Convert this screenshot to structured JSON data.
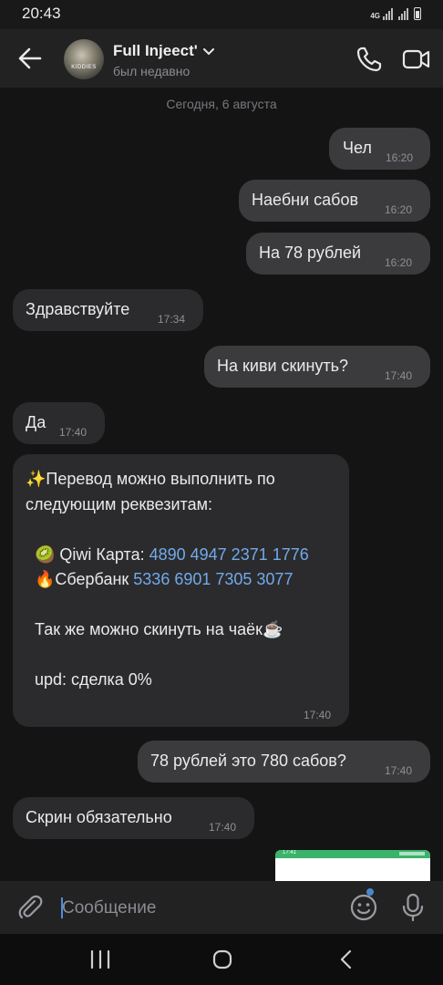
{
  "status_bar": {
    "time": "20:43",
    "network": "4G"
  },
  "header": {
    "back_icon": "arrow-left-icon",
    "avatar_text": "KIDDIES",
    "name": "Full Injeect'",
    "status": "был недавно",
    "call_icon": "phone-icon",
    "video_icon": "video-camera-icon"
  },
  "chat": {
    "date_separator": "Сегодня, 6 августа",
    "messages": [
      {
        "direction": "out",
        "text": "Чел",
        "time": "16:20"
      },
      {
        "direction": "out",
        "text": "Наебни сабов",
        "time": "16:20"
      },
      {
        "direction": "out",
        "text": "На 78 рублей",
        "time": "16:20"
      },
      {
        "direction": "in",
        "text": "Здравствуйте",
        "time": "17:34"
      },
      {
        "direction": "out",
        "text": "На киви скинуть?",
        "time": "17:40"
      },
      {
        "direction": "in",
        "text": "Да",
        "time": "17:40"
      },
      {
        "direction": "in",
        "time": "17:40",
        "parts": {
          "line1": "✨Перевод можно выполнить по",
          "line2": "следующим реквезитам:",
          "qiwi_label": "  🥝 Qiwi Карта: ",
          "qiwi_number": "4890 4947 2371 1776",
          "sber_label": "  🔥Сбербанк ",
          "sber_number": "5336 6901 7305 3077",
          "tea": "  Так же можно скинуть на чаёк☕",
          "upd": "  upd: сделка 0%"
        }
      },
      {
        "direction": "out",
        "text": "78 рублей это 780 сабов?",
        "time": "17:40"
      },
      {
        "direction": "in",
        "text": "Скрин обязательно",
        "time": "17:40"
      }
    ],
    "screenshot_preview_time": "17:41"
  },
  "composer": {
    "attach_icon": "paperclip-icon",
    "placeholder": "Сообщение",
    "emoji_icon": "smiley-icon",
    "mic_icon": "microphone-icon"
  },
  "navbar": {
    "recent_icon": "recent-apps-icon",
    "home_icon": "home-icon",
    "back_icon": "back-chevron-icon"
  },
  "colors": {
    "background": "#141414",
    "outgoing_bubble": "#3b3b3d",
    "incoming_bubble": "#2b2b2d",
    "link": "#71aaeb",
    "accent": "#4986cc"
  }
}
